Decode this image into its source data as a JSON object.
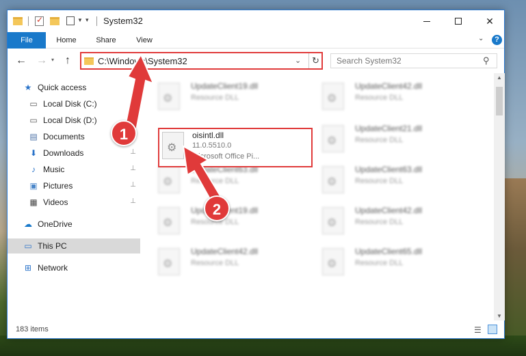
{
  "window": {
    "title": "System32"
  },
  "ribbon": {
    "tabs": [
      "File",
      "Home",
      "Share",
      "View"
    ]
  },
  "address": {
    "path": "C:\\Windows\\System32"
  },
  "search": {
    "placeholder": "Search System32"
  },
  "sidebar": {
    "items": [
      {
        "label": "Quick access",
        "icon": "star-icon"
      },
      {
        "label": "Local Disk (C:)",
        "icon": "drive-icon"
      },
      {
        "label": "Local Disk (D:)",
        "icon": "drive-icon"
      },
      {
        "label": "Documents",
        "icon": "documents-icon"
      },
      {
        "label": "Downloads",
        "icon": "download-icon"
      },
      {
        "label": "Music",
        "icon": "music-icon"
      },
      {
        "label": "Pictures",
        "icon": "pictures-icon"
      },
      {
        "label": "Videos",
        "icon": "videos-icon"
      },
      {
        "label": "OneDrive",
        "icon": "cloud-icon"
      },
      {
        "label": "This PC",
        "icon": "computer-icon"
      },
      {
        "label": "Network",
        "icon": "network-icon"
      }
    ]
  },
  "files": {
    "highlighted": {
      "name": "oisintl.dll",
      "version": "11.0.5510.0",
      "description": "Microsoft Office Pi..."
    },
    "blurred": [
      {
        "name": "UpdateClient19.dll",
        "type": "Resource DLL"
      },
      {
        "name": "UpdateClient42.dll",
        "type": "Resource DLL"
      },
      {
        "name": "UpdateClient21.dll",
        "type": "Resource DLL"
      },
      {
        "name": "UpdateClient63.dll",
        "type": "Resource DLL"
      },
      {
        "name": "UpdateClient63.dll",
        "type": "Resource DLL"
      },
      {
        "name": "UpdateClient19.dll",
        "type": "Resource DLL"
      },
      {
        "name": "UpdateClient42.dll",
        "type": "Resource DLL"
      },
      {
        "name": "UpdateClient42.dll",
        "type": "Resource DLL"
      },
      {
        "name": "UpdateClient65.dll",
        "type": "Resource DLL"
      }
    ]
  },
  "status": {
    "items_count": "183 items"
  },
  "annotations": {
    "step1": "1",
    "step2": "2",
    "color": "#e03a3a"
  }
}
